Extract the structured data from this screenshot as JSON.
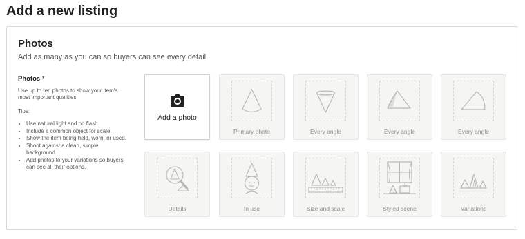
{
  "page": {
    "title": "Add a new listing"
  },
  "photos": {
    "section_title": "Photos",
    "section_subtitle": "Add as many as you can so buyers can see every detail.",
    "field_label": "Photos",
    "required_mark": "*",
    "description": "Use up to ten photos to show your item's most important qualities.",
    "tips_heading": "Tips:",
    "tips": [
      "Use natural light and no flash.",
      "Include a common object for scale.",
      "Show the item being held, worn, or used.",
      "Shoot against a clean, simple background.",
      "Add photos to your variations so buyers can see all their options."
    ],
    "add_photo_label": "Add a photo",
    "slots": [
      {
        "label": "Primary photo",
        "icon": "cone-upright-icon"
      },
      {
        "label": "Every angle",
        "icon": "cone-inverted-icon"
      },
      {
        "label": "Every angle",
        "icon": "cone-tilted-icon"
      },
      {
        "label": "Every angle",
        "icon": "cone-side-icon"
      },
      {
        "label": "Details",
        "icon": "magnifier-cone-icon"
      },
      {
        "label": "In use",
        "icon": "cone-hat-face-icon"
      },
      {
        "label": "Size and scale",
        "icon": "cones-ruler-icon"
      },
      {
        "label": "Styled scene",
        "icon": "window-scene-icon"
      },
      {
        "label": "Variations",
        "icon": "three-cones-icon"
      }
    ]
  },
  "colors": {
    "tile_background": "#f5f5f3",
    "dashed_frame": "#d6d6d2",
    "illustration_stroke": "#b9b9b4",
    "muted_text": "#8a8a8a"
  }
}
